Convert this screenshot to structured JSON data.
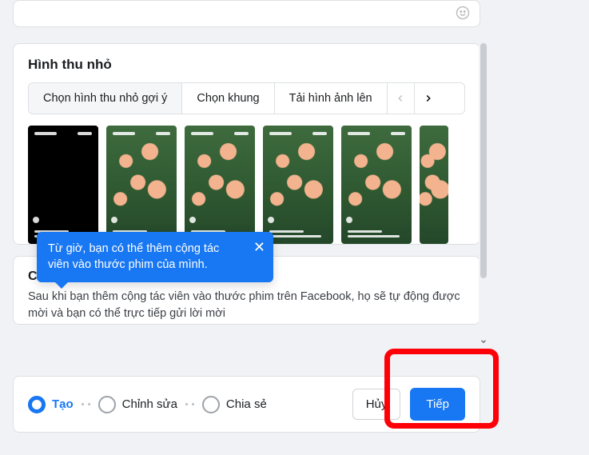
{
  "thumbnail_section": {
    "title": "Hình thu nhỏ",
    "tabs": [
      "Chọn hình thu nhỏ gợi ý",
      "Chọn khung",
      "Tải hình ảnh lên"
    ]
  },
  "tooltip": {
    "message": "Từ giờ, bạn có thể thêm cộng tác viên vào thước phim của mình.",
    "close_glyph": "✕"
  },
  "collaborator_section": {
    "title": "Cộng tác viên",
    "info_glyph": "i",
    "description": "Sau khi bạn thêm cộng tác viên vào thước phim trên Facebook, họ sẽ tự động được mời và bạn có thể trực tiếp gửi lời mời"
  },
  "footer": {
    "steps": [
      "Tạo",
      "Chỉnh sửa",
      "Chia sẻ"
    ],
    "cancel_label": "Hủy",
    "next_label": "Tiếp"
  }
}
